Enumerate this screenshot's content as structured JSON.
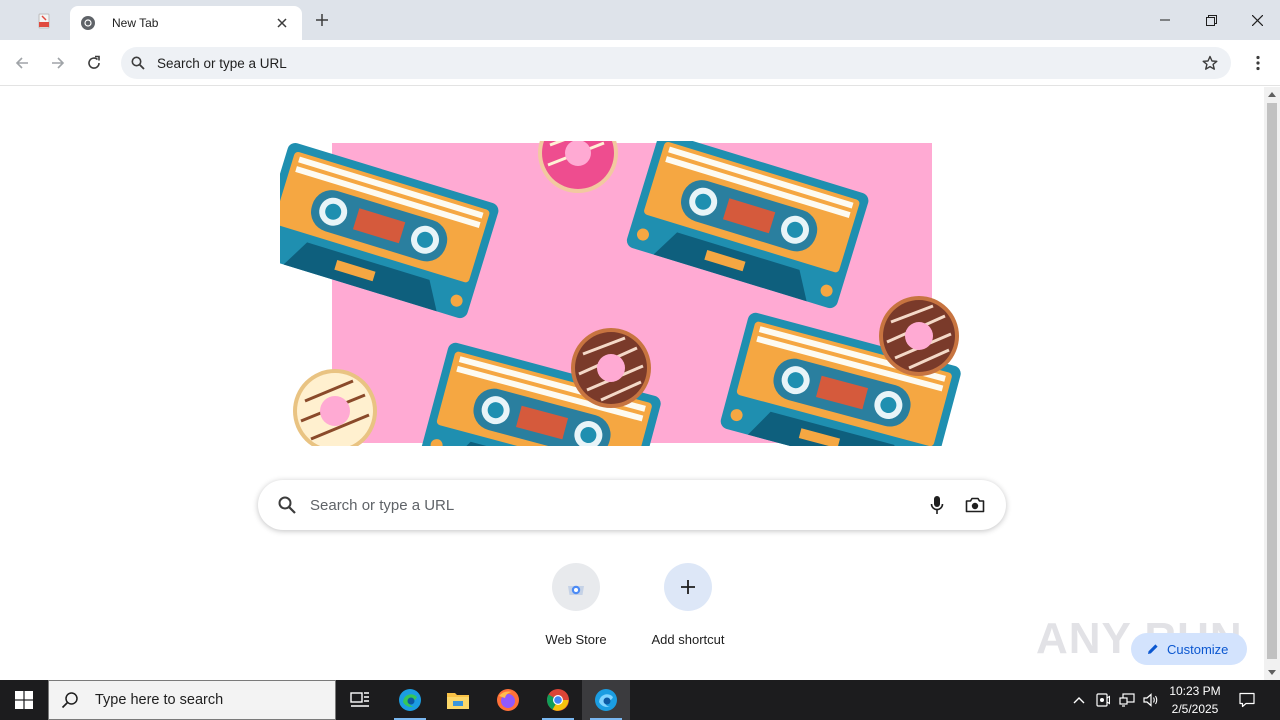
{
  "browser": {
    "tab_title": "New Tab",
    "omnibox_text": "Search or type a URL"
  },
  "ntp": {
    "search_placeholder": "Search or type a URL",
    "shortcuts": [
      {
        "label": "Web Store",
        "icon": "webstore-icon"
      },
      {
        "label": "Add shortcut",
        "icon": "plus-icon"
      }
    ],
    "customize_label": "Customize",
    "watermark_text": "ANY RUN",
    "doodle_colors": {
      "background": "#ffaad3",
      "cassette_blue": "#1f8fb0",
      "cassette_orange": "#f5a742"
    }
  },
  "taskbar": {
    "search_placeholder": "Type here to search",
    "time": "10:23 PM",
    "date": "2/5/2025"
  },
  "colors": {
    "accent": "#0b57d0",
    "tabstrip": "#dee3ea",
    "taskbar": "#1c1c1e"
  }
}
